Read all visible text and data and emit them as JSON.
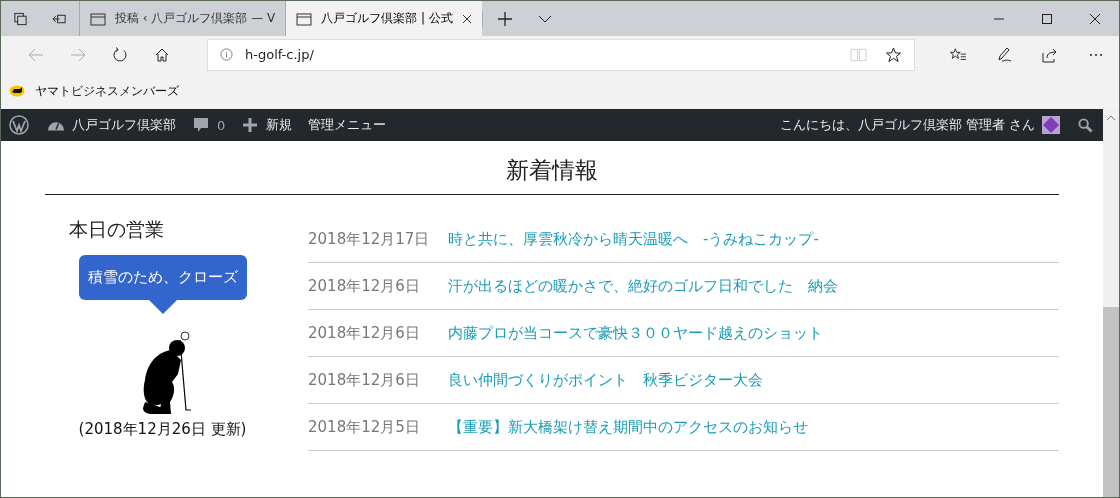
{
  "tabs": [
    {
      "title": "投稿 ‹ 八戸ゴルフ倶楽部 — V",
      "selected": false
    },
    {
      "title": "八戸ゴルフ倶楽部 | 公式",
      "selected": true
    }
  ],
  "address": "h-golf-c.jp/",
  "favorites": [
    "ヤマトビジネスメンバーズ"
  ],
  "admin_bar": {
    "site": "八戸ゴルフ倶楽部",
    "comments": "0",
    "new": "新規",
    "menu": "管理メニュー",
    "greeting": "こんにちは、八戸ゴルフ倶楽部 管理者 さん"
  },
  "section_title": "新着情報",
  "today": {
    "heading": "本日の営業",
    "status": "積雪のため、クローズ",
    "updated": "(2018年12月26日 更新)"
  },
  "news": [
    {
      "date": "2018年12月17日",
      "title": "時と共に、厚雲秋冷から晴天温暖へ　-うみねこカップ-"
    },
    {
      "date": "2018年12月6日",
      "title": "汗が出るほどの暖かさで、絶好のゴルフ日和でした　納会"
    },
    {
      "date": "2018年12月6日",
      "title": "内藤プロが当コースで豪快３００ヤード越えのショット"
    },
    {
      "date": "2018年12月6日",
      "title": "良い仲間づくりがポイント　秋季ビジター大会"
    },
    {
      "date": "2018年12月5日",
      "title": "【重要】新大橋架け替え期間中のアクセスのお知らせ"
    }
  ]
}
